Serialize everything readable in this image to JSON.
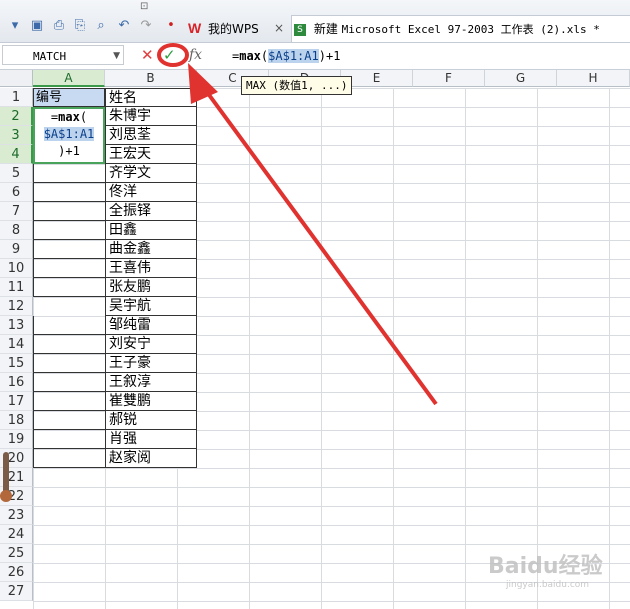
{
  "titlebar": {
    "mark": "⊡",
    "wps_logo": "W",
    "wps_tab": "我的WPS",
    "file_tab_prefix": "新建",
    "file_tab_name": "Microsoft Excel 97-2003 工作表 (2).xls *",
    "xls_icon": "S",
    "close": "×"
  },
  "formula_bar": {
    "name_box": "MATCH",
    "cancel": "✕",
    "confirm": "✓",
    "fx": "fx",
    "formula_prefix": "=",
    "formula_func": "max",
    "formula_paren": "(",
    "formula_ref_a": "$A$1:A",
    "formula_ref_b": "1",
    "formula_suffix": ")+1"
  },
  "tooltip": "MAX (数值1, ...)",
  "columns": [
    "A",
    "B",
    "C",
    "D",
    "E",
    "F",
    "G",
    "H"
  ],
  "rows": [
    "1",
    "2",
    "3",
    "4",
    "5",
    "6",
    "7",
    "8",
    "9",
    "10",
    "11",
    "12",
    "13",
    "14",
    "15",
    "16",
    "17",
    "18",
    "19",
    "20",
    "21",
    "22",
    "23",
    "24",
    "25",
    "26",
    "27"
  ],
  "colA": {
    "header_cell": "编号",
    "edit_line1_prefix": "=",
    "edit_line1_func": "max",
    "edit_line1_paren": "(",
    "edit_line2": "$A$1:A1",
    "edit_line3": ")+1"
  },
  "colB": [
    "姓名",
    "朱博宇",
    "刘思荃",
    "王宏天",
    "齐学文",
    "佟洋",
    "全振铎",
    "田鑫",
    "曲金鑫",
    "王喜伟",
    "张友鹏",
    "吴宇航",
    "邹纯雷",
    "刘安宁",
    "王子豪",
    "王叙淳",
    "崔雙鹏",
    "郝锐",
    "肖强",
    "赵家阅"
  ],
  "annotation": {
    "color": "#e0322f"
  },
  "watermark": {
    "main": "Baidu经验",
    "sub": "jingyan.baidu.com"
  }
}
